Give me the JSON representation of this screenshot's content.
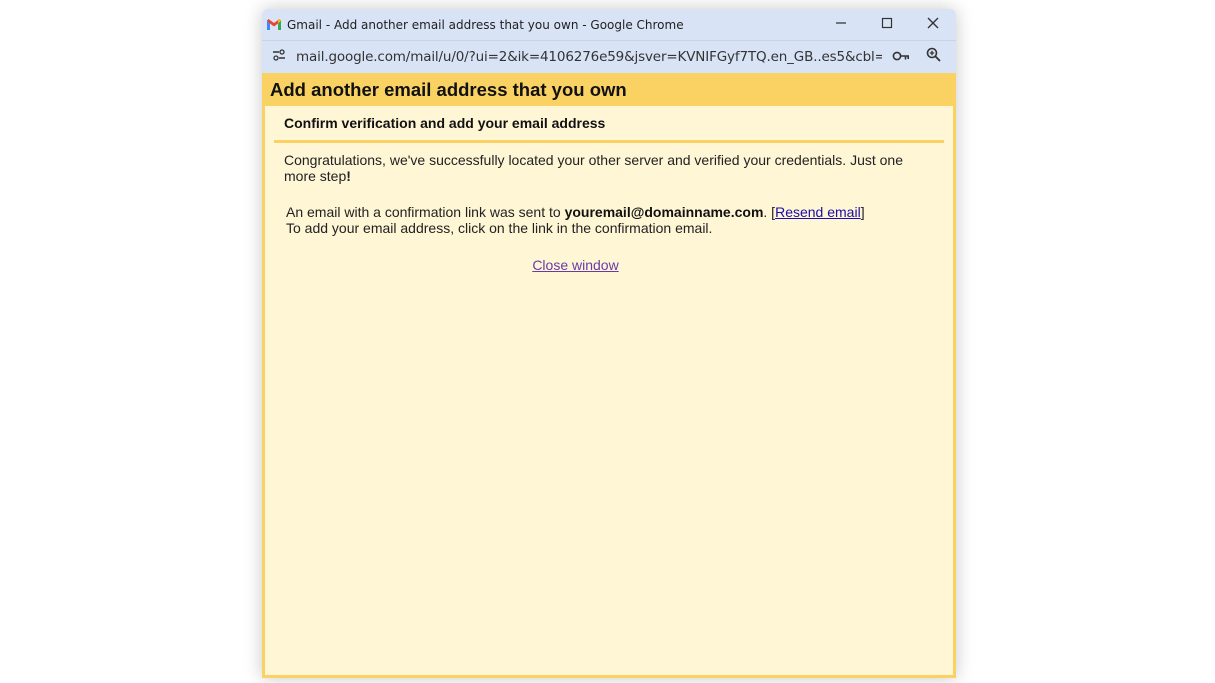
{
  "window": {
    "title": "Gmail - Add another email address that you own - Google Chrome",
    "url": "mail.google.com/mail/u/0/?ui=2&ik=4106276e59&jsver=KVNIFGyf7TQ.en_GB..es5&cbl=gma..."
  },
  "icons": {
    "app": "gmail-logo-icon",
    "site_info": "tune-icon",
    "password": "key-icon",
    "zoom": "zoom-in-icon",
    "minimize": "minimize-icon",
    "maximize": "maximize-icon",
    "close": "close-icon"
  },
  "colors": {
    "header_bg": "#fad163",
    "content_bg": "#fff6d6",
    "titlebar_bg": "#d8e3f6",
    "link": "#1a0dab",
    "visited_link": "#6a3aa8"
  },
  "page": {
    "heading": "Add another email address that you own",
    "section_title": "Confirm verification and add your email address",
    "congrats_text": "Congratulations, we've successfully located your other server and verified your credentials. Just one more step",
    "congrats_exclaim": "!",
    "sent_prefix": "An email with a confirmation link was sent to ",
    "email_address": "youremail@domainname.com",
    "sent_suffix": ". [",
    "resend_label": "Resend email",
    "bracket_close": "]",
    "instruction": "To add your email address, click on the link in the confirmation email.",
    "close_label": "Close window"
  }
}
